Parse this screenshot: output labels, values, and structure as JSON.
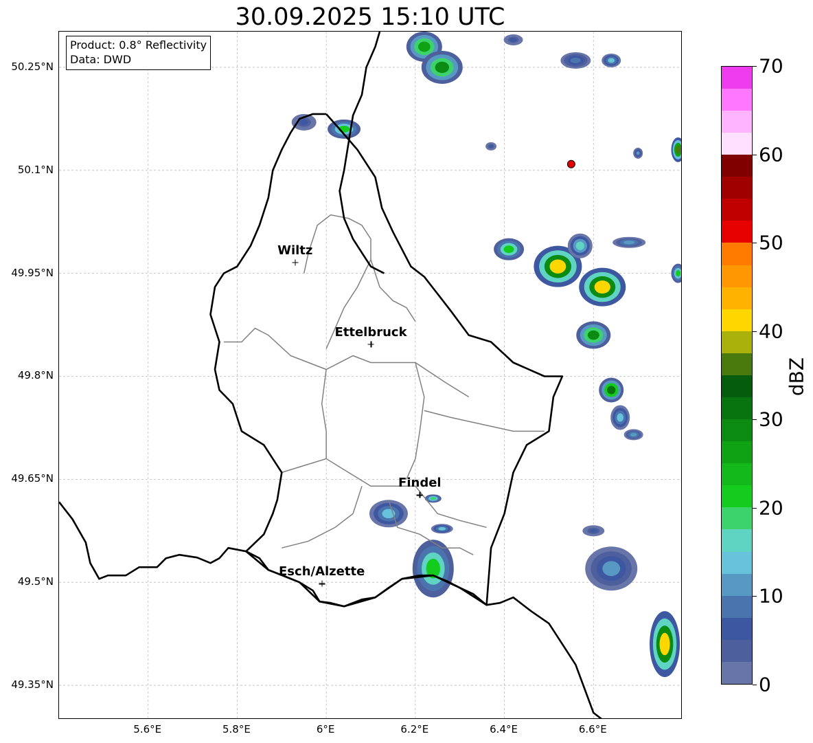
{
  "title": "30.09.2025 15:10 UTC",
  "info": {
    "product": "Product: 0.8° Reflectivity",
    "data": "Data: DWD"
  },
  "cities": [
    {
      "name": "Wiltz",
      "lon": 5.93,
      "lat": 49.966
    },
    {
      "name": "Ettelbruck",
      "lon": 6.1,
      "lat": 49.847
    },
    {
      "name": "Findel",
      "lon": 6.21,
      "lat": 49.627
    },
    {
      "name": "Esch/Alzette",
      "lon": 5.99,
      "lat": 49.498
    }
  ],
  "radar_site": {
    "lon": 6.55,
    "lat": 50.109,
    "color": "#e00000"
  },
  "extent": {
    "lon_min": 5.4,
    "lon_max": 6.8,
    "lat_min": 49.3,
    "lat_max": 50.302
  },
  "lat_ticks": [
    {
      "label": "50.25°N",
      "lat": 50.25
    },
    {
      "label": "50.1°N",
      "lat": 50.1
    },
    {
      "label": "49.95°N",
      "lat": 49.95
    },
    {
      "label": "49.8°N",
      "lat": 49.8
    },
    {
      "label": "49.65°N",
      "lat": 49.65
    },
    {
      "label": "49.5°N",
      "lat": 49.5
    },
    {
      "label": "49.35°N",
      "lat": 49.35
    }
  ],
  "lon_ticks": [
    {
      "label": "5.6°E",
      "lon": 5.6
    },
    {
      "label": "5.8°E",
      "lon": 5.8
    },
    {
      "label": "6°E",
      "lon": 6.0
    },
    {
      "label": "6.2°E",
      "lon": 6.2
    },
    {
      "label": "6.4°E",
      "lon": 6.4
    },
    {
      "label": "6.6°E",
      "lon": 6.6
    }
  ],
  "colorbar": {
    "unit": "dBZ",
    "min": 0,
    "max": 70,
    "tick_labels": [
      "0",
      "10",
      "20",
      "30",
      "40",
      "50",
      "60",
      "70"
    ],
    "tick_values": [
      0,
      10,
      20,
      30,
      40,
      50,
      60,
      70
    ],
    "colors": [
      "#6775a8",
      "#4d5f9c",
      "#3d57a0",
      "#4a74ad",
      "#5899c4",
      "#67c2dc",
      "#5fd4c3",
      "#3cd36c",
      "#14cc1e",
      "#13b81a",
      "#10a215",
      "#0b8b12",
      "#087410",
      "#055c0c",
      "#4a7a0e",
      "#aab20a",
      "#ffd700",
      "#ffb300",
      "#ff9800",
      "#ff7b00",
      "#e60000",
      "#c00000",
      "#a00000",
      "#800000",
      "#ffe1ff",
      "#ffb4ff",
      "#ff78ff",
      "#ee3cee"
    ]
  },
  "borders": {
    "country": [
      [
        [
          5.4,
          49.617
        ],
        [
          5.43,
          49.592
        ],
        [
          5.46,
          49.558
        ],
        [
          5.47,
          49.528
        ],
        [
          5.49,
          49.505
        ],
        [
          5.51,
          49.51
        ],
        [
          5.55,
          49.51
        ],
        [
          5.58,
          49.522
        ],
        [
          5.62,
          49.522
        ],
        [
          5.64,
          49.535
        ],
        [
          5.67,
          49.54
        ],
        [
          5.71,
          49.536
        ],
        [
          5.74,
          49.528
        ],
        [
          5.76,
          49.535
        ],
        [
          5.78,
          49.55
        ],
        [
          5.82,
          49.545
        ],
        [
          5.85,
          49.535
        ],
        [
          5.87,
          49.518
        ],
        [
          5.91,
          49.508
        ],
        [
          5.94,
          49.5
        ],
        [
          5.97,
          49.488
        ],
        [
          5.985,
          49.472
        ],
        [
          6.01,
          49.47
        ],
        [
          6.04,
          49.465
        ],
        [
          6.08,
          49.475
        ],
        [
          6.11,
          49.478
        ],
        [
          6.14,
          49.492
        ],
        [
          6.17,
          49.505
        ],
        [
          6.21,
          49.51
        ],
        [
          6.24,
          49.51
        ],
        [
          6.27,
          49.502
        ],
        [
          6.3,
          49.492
        ],
        [
          6.33,
          49.483
        ],
        [
          6.36,
          49.467
        ],
        [
          6.39,
          49.47
        ],
        [
          6.42,
          49.478
        ],
        [
          6.46,
          49.458
        ],
        [
          6.5,
          49.44
        ],
        [
          6.53,
          49.41
        ],
        [
          6.56,
          49.38
        ],
        [
          6.58,
          49.345
        ],
        [
          6.6,
          49.31
        ],
        [
          6.62,
          49.3
        ]
      ]
    ],
    "luxembourg": [
      [
        6.0,
        50.182
      ],
      [
        6.03,
        50.16
      ],
      [
        6.07,
        50.13
      ],
      [
        6.11,
        50.09
      ],
      [
        6.125,
        50.045
      ],
      [
        6.15,
        50.01
      ],
      [
        6.17,
        49.985
      ],
      [
        6.19,
        49.96
      ],
      [
        6.22,
        49.945
      ],
      [
        6.25,
        49.92
      ],
      [
        6.28,
        49.895
      ],
      [
        6.32,
        49.86
      ],
      [
        6.37,
        49.85
      ],
      [
        6.42,
        49.82
      ],
      [
        6.49,
        49.8
      ],
      [
        6.53,
        49.8
      ],
      [
        6.51,
        49.77
      ],
      [
        6.5,
        49.72
      ],
      [
        6.45,
        49.7
      ],
      [
        6.42,
        49.66
      ],
      [
        6.4,
        49.6
      ],
      [
        6.37,
        49.55
      ],
      [
        6.36,
        49.467
      ],
      [
        6.3,
        49.492
      ],
      [
        6.24,
        49.51
      ],
      [
        6.17,
        49.505
      ],
      [
        6.11,
        49.478
      ],
      [
        6.04,
        49.465
      ],
      [
        5.985,
        49.472
      ],
      [
        5.94,
        49.5
      ],
      [
        5.87,
        49.518
      ],
      [
        5.82,
        49.545
      ],
      [
        5.86,
        49.57
      ],
      [
        5.88,
        49.6
      ],
      [
        5.89,
        49.62
      ],
      [
        5.9,
        49.66
      ],
      [
        5.86,
        49.7
      ],
      [
        5.81,
        49.72
      ],
      [
        5.79,
        49.76
      ],
      [
        5.76,
        49.78
      ],
      [
        5.75,
        49.81
      ],
      [
        5.76,
        49.85
      ],
      [
        5.74,
        49.89
      ],
      [
        5.75,
        49.93
      ],
      [
        5.77,
        49.95
      ],
      [
        5.8,
        49.96
      ],
      [
        5.83,
        49.99
      ],
      [
        5.85,
        50.02
      ],
      [
        5.87,
        50.06
      ],
      [
        5.88,
        50.1
      ],
      [
        5.9,
        50.13
      ],
      [
        5.92,
        50.155
      ],
      [
        5.94,
        50.175
      ],
      [
        5.97,
        50.182
      ],
      [
        6.0,
        50.182
      ]
    ],
    "german_border_north": [
      [
        6.12,
        50.302
      ],
      [
        6.11,
        50.28
      ],
      [
        6.09,
        50.25
      ],
      [
        6.08,
        50.21
      ],
      [
        6.06,
        50.18
      ],
      [
        6.05,
        50.14
      ],
      [
        6.04,
        50.1
      ],
      [
        6.03,
        50.07
      ],
      [
        6.04,
        50.03
      ],
      [
        6.06,
        50.0
      ],
      [
        6.08,
        49.98
      ],
      [
        6.1,
        49.96
      ],
      [
        6.13,
        49.95
      ]
    ],
    "cantons": [
      [
        [
          5.95,
          49.95
        ],
        [
          5.96,
          49.98
        ],
        [
          5.98,
          50.02
        ],
        [
          6.01,
          50.035
        ],
        [
          6.05,
          50.03
        ],
        [
          6.08,
          50.02
        ],
        [
          6.1,
          50.0
        ],
        [
          6.1,
          49.97
        ]
      ],
      [
        [
          5.77,
          49.85
        ],
        [
          5.81,
          49.85
        ],
        [
          5.84,
          49.87
        ],
        [
          5.87,
          49.86
        ],
        [
          5.92,
          49.83
        ],
        [
          5.96,
          49.82
        ],
        [
          6.0,
          49.81
        ],
        [
          6.06,
          49.83
        ],
        [
          6.1,
          49.82
        ],
        [
          6.15,
          49.82
        ],
        [
          6.2,
          49.82
        ],
        [
          6.27,
          49.79
        ],
        [
          6.32,
          49.77
        ]
      ],
      [
        [
          6.1,
          49.97
        ],
        [
          6.07,
          49.93
        ],
        [
          6.04,
          49.9
        ],
        [
          6.02,
          49.87
        ],
        [
          6.0,
          49.84
        ]
      ],
      [
        [
          6.1,
          49.97
        ],
        [
          6.12,
          49.93
        ],
        [
          6.15,
          49.91
        ],
        [
          6.18,
          49.9
        ],
        [
          6.2,
          49.88
        ]
      ],
      [
        [
          5.9,
          49.66
        ],
        [
          5.95,
          49.67
        ],
        [
          6.0,
          49.68
        ],
        [
          6.05,
          49.66
        ],
        [
          6.1,
          49.64
        ],
        [
          6.15,
          49.64
        ],
        [
          6.2,
          49.64
        ],
        [
          6.25,
          49.6
        ],
        [
          6.3,
          49.59
        ],
        [
          6.36,
          49.58
        ]
      ],
      [
        [
          6.0,
          49.81
        ],
        [
          5.99,
          49.76
        ],
        [
          6.0,
          49.72
        ],
        [
          6.0,
          49.68
        ]
      ],
      [
        [
          6.2,
          49.82
        ],
        [
          6.22,
          49.77
        ],
        [
          6.21,
          49.72
        ],
        [
          6.2,
          49.68
        ],
        [
          6.18,
          49.65
        ]
      ],
      [
        [
          6.22,
          49.75
        ],
        [
          6.28,
          49.74
        ],
        [
          6.35,
          49.73
        ],
        [
          6.42,
          49.72
        ],
        [
          6.49,
          49.72
        ]
      ],
      [
        [
          6.08,
          49.64
        ],
        [
          6.06,
          49.6
        ],
        [
          6.02,
          49.58
        ],
        [
          5.96,
          49.56
        ],
        [
          5.9,
          49.55
        ]
      ],
      [
        [
          6.14,
          49.62
        ],
        [
          6.16,
          49.58
        ],
        [
          6.21,
          49.57
        ],
        [
          6.26,
          49.55
        ],
        [
          6.3,
          49.55
        ],
        [
          6.33,
          49.54
        ]
      ]
    ]
  },
  "precip_cells": [
    {
      "lon": 6.22,
      "lat": 50.28,
      "rx": 26,
      "ry": 22,
      "dbz": 27
    },
    {
      "lon": 6.26,
      "lat": 50.25,
      "rx": 30,
      "ry": 24,
      "dbz": 28
    },
    {
      "lon": 6.42,
      "lat": 50.29,
      "rx": 14,
      "ry": 8,
      "dbz": 6
    },
    {
      "lon": 6.56,
      "lat": 50.26,
      "rx": 22,
      "ry": 12,
      "dbz": 8
    },
    {
      "lon": 6.64,
      "lat": 50.26,
      "rx": 14,
      "ry": 10,
      "dbz": 14
    },
    {
      "lon": 5.95,
      "lat": 50.17,
      "rx": 18,
      "ry": 12,
      "dbz": 6
    },
    {
      "lon": 6.04,
      "lat": 50.16,
      "rx": 24,
      "ry": 14,
      "dbz": 20
    },
    {
      "lon": 6.37,
      "lat": 50.135,
      "rx": 8,
      "ry": 6,
      "dbz": 6
    },
    {
      "lon": 6.7,
      "lat": 50.125,
      "rx": 7,
      "ry": 8,
      "dbz": 10
    },
    {
      "lon": 6.79,
      "lat": 50.13,
      "rx": 10,
      "ry": 18,
      "dbz": 36
    },
    {
      "lon": 6.41,
      "lat": 49.985,
      "rx": 22,
      "ry": 16,
      "dbz": 22
    },
    {
      "lon": 6.52,
      "lat": 49.96,
      "rx": 35,
      "ry": 30,
      "dbz": 40
    },
    {
      "lon": 6.57,
      "lat": 49.99,
      "rx": 18,
      "ry": 18,
      "dbz": 15
    },
    {
      "lon": 6.68,
      "lat": 49.995,
      "rx": 24,
      "ry": 8,
      "dbz": 12
    },
    {
      "lon": 6.79,
      "lat": 49.95,
      "rx": 10,
      "ry": 14,
      "dbz": 20
    },
    {
      "lon": 6.62,
      "lat": 49.93,
      "rx": 34,
      "ry": 28,
      "dbz": 42
    },
    {
      "lon": 6.6,
      "lat": 49.86,
      "rx": 25,
      "ry": 20,
      "dbz": 28
    },
    {
      "lon": 6.64,
      "lat": 49.78,
      "rx": 18,
      "ry": 18,
      "dbz": 30
    },
    {
      "lon": 6.66,
      "lat": 49.74,
      "rx": 14,
      "ry": 18,
      "dbz": 14
    },
    {
      "lon": 6.69,
      "lat": 49.715,
      "rx": 14,
      "ry": 8,
      "dbz": 12
    },
    {
      "lon": 6.14,
      "lat": 49.6,
      "rx": 28,
      "ry": 20,
      "dbz": 14
    },
    {
      "lon": 6.24,
      "lat": 49.622,
      "rx": 12,
      "ry": 6,
      "dbz": 19
    },
    {
      "lon": 6.26,
      "lat": 49.578,
      "rx": 16,
      "ry": 7,
      "dbz": 14
    },
    {
      "lon": 6.24,
      "lat": 49.52,
      "rx": 30,
      "ry": 42,
      "dbz": 22
    },
    {
      "lon": 6.6,
      "lat": 49.575,
      "rx": 16,
      "ry": 8,
      "dbz": 6
    },
    {
      "lon": 6.64,
      "lat": 49.52,
      "rx": 38,
      "ry": 32,
      "dbz": 10
    },
    {
      "lon": 6.76,
      "lat": 49.41,
      "rx": 22,
      "ry": 48,
      "dbz": 40
    }
  ]
}
